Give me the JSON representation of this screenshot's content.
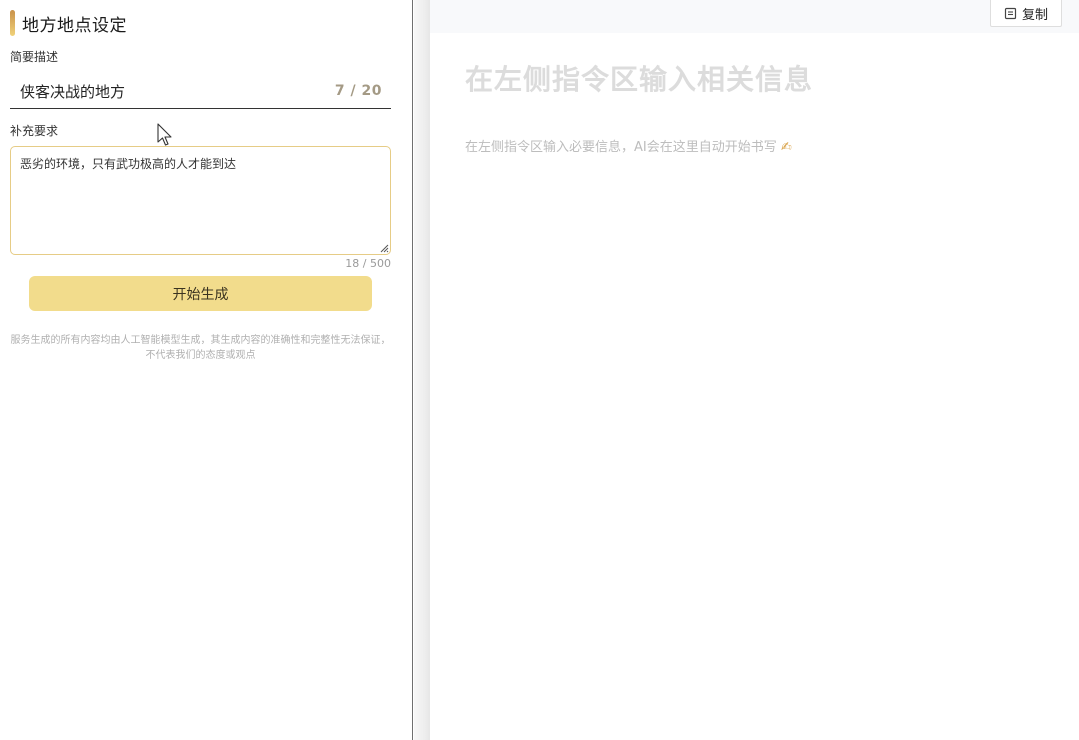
{
  "left_panel": {
    "title": "地方地点设定",
    "brief": {
      "label": "简要描述",
      "value": "侠客决战的地方",
      "count": "7 / 20"
    },
    "extra": {
      "label": "补充要求",
      "value": "恶劣的环境，只有武功极高的人才能到达",
      "count": "18 / 500"
    },
    "generate_button": "开始生成",
    "disclaimer": "服务生成的所有内容均由人工智能模型生成，其生成内容的准确性和完整性无法保证，不代表我们的态度或观点"
  },
  "right_panel": {
    "copy_button": "复制",
    "placeholder_title": "在左侧指令区输入相关信息",
    "placeholder_text": "在左侧指令区输入必要信息，AI会在这里自动开始书写",
    "placeholder_emoji": "✍"
  },
  "colors": {
    "accent": "#f2dc8c",
    "textarea_border": "#e6cc86",
    "title_bar_top": "#c9924a",
    "title_bar_bottom": "#f0d27a"
  },
  "icons": {
    "title_marker": "accent-bar-icon",
    "copy": "copy-icon",
    "resize": "resize-handle-icon",
    "cursor": "mouse-cursor-icon"
  }
}
